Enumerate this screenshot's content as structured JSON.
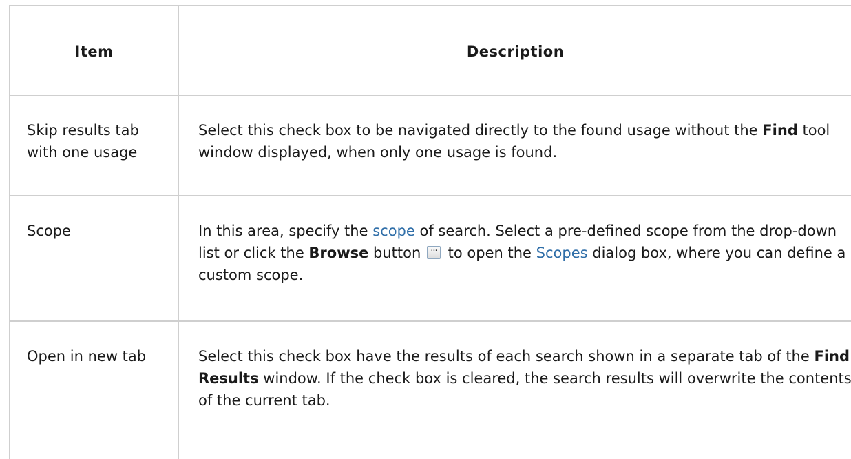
{
  "table": {
    "headers": {
      "item": "Item",
      "description": "Description"
    },
    "rows": [
      {
        "item": "Skip results tab with one usage",
        "desc": {
          "t1": "Select this check box to be navigated directly to the found usage without the ",
          "b1": "Find",
          "t2": " tool window displayed, when only one usage is found."
        }
      },
      {
        "item": "Scope",
        "desc": {
          "t1": "In this area, specify the ",
          "link1": "scope",
          "t2": " of search. Select a pre-defined scope from the drop-down list or click the ",
          "b1": "Browse",
          "t3": " button ",
          "icon": "browse-ellipsis-icon",
          "t4": " to open the ",
          "link2": "Scopes",
          "t5": " dialog box, where you can define a custom scope."
        }
      },
      {
        "item": "Open in new tab",
        "desc": {
          "t1": "Select this check box have the results of each search shown in a separate tab of the ",
          "b1": "Find Results",
          "t2": " window. If the check box is cleared, the search results will overwrite the contents of the current tab."
        }
      }
    ]
  },
  "colors": {
    "link": "#2f6ea8",
    "border": "#cfcfcf",
    "text": "#1a1a1a"
  }
}
